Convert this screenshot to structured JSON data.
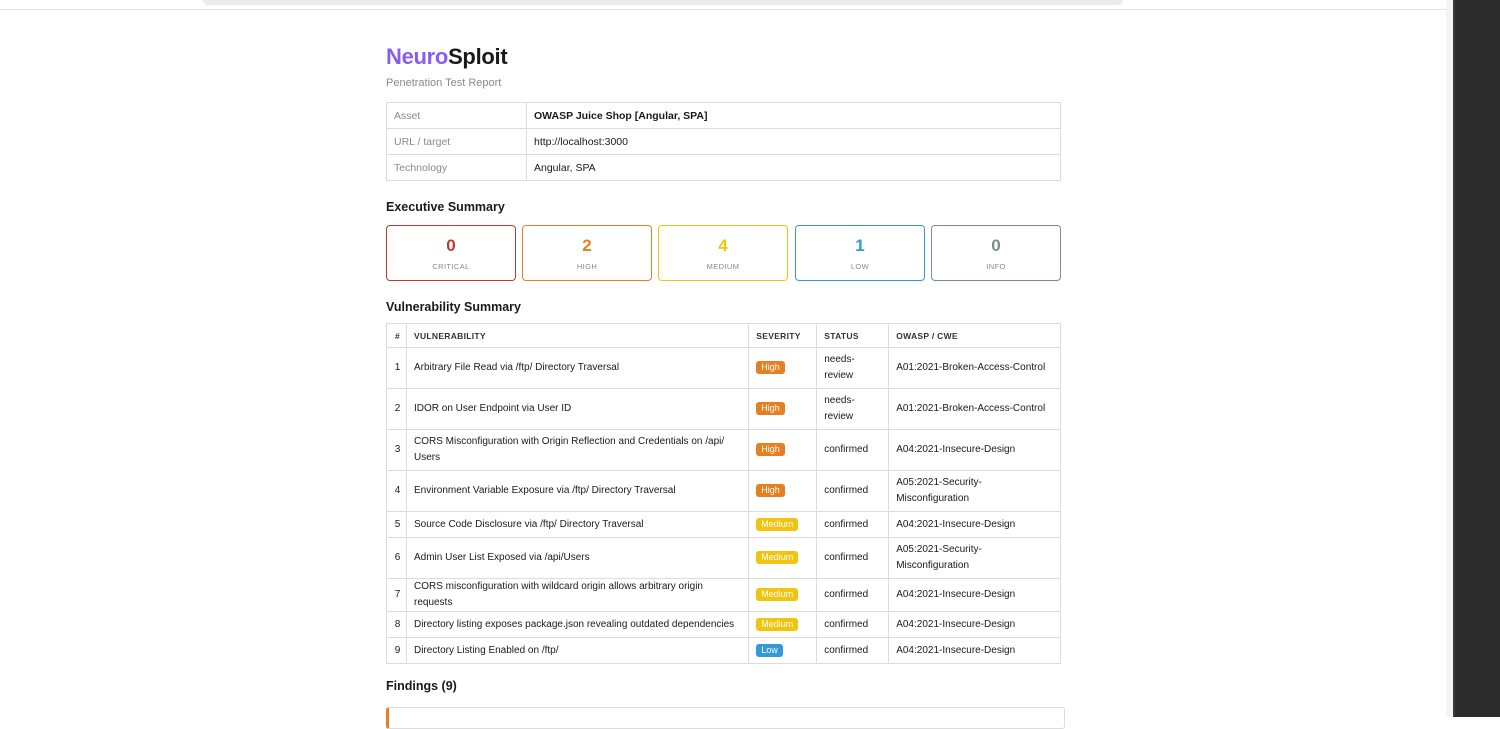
{
  "brand": {
    "part1": "Neuro",
    "part2": "Sploit"
  },
  "subtitle": "Penetration Test Report",
  "info": [
    {
      "key": "Asset",
      "value": "OWASP Juice Shop [Angular, SPA]"
    },
    {
      "key": "URL / target",
      "value": "http://localhost:3000"
    },
    {
      "key": "Technology",
      "value": "Angular, SPA"
    }
  ],
  "executive_summary": {
    "heading": "Executive Summary",
    "cards": [
      {
        "count": "0",
        "label": "CRITICAL",
        "color": "#c0392b"
      },
      {
        "count": "2",
        "label": "HIGH",
        "color": "#e67e22"
      },
      {
        "count": "4",
        "label": "MEDIUM",
        "color": "#f1c40f"
      },
      {
        "count": "1",
        "label": "LOW",
        "color": "#3498db"
      },
      {
        "count": "0",
        "label": "INFO",
        "color": "#7f8c8d"
      }
    ]
  },
  "vulnerability_summary": {
    "heading": "Vulnerability Summary",
    "columns": [
      "#",
      "VULNERABILITY",
      "SEVERITY",
      "STATUS",
      "OWASP / CWE"
    ],
    "rows": [
      {
        "num": "1",
        "name": "Arbitrary File Read via /ftp/ Directory Traversal",
        "severity": "High",
        "status": "needs-review",
        "owasp": "A01:2021-Broken-Access-Control"
      },
      {
        "num": "2",
        "name": "IDOR on User Endpoint via User ID",
        "severity": "High",
        "status": "needs-review",
        "owasp": "A01:2021-Broken-Access-Control"
      },
      {
        "num": "3",
        "name": "CORS Misconfiguration with Origin Reflection and Credentials on /api/ Users",
        "severity": "High",
        "status": "confirmed",
        "owasp": "A04:2021-Insecure-Design"
      },
      {
        "num": "4",
        "name": "Environment Variable Exposure via /ftp/ Directory Traversal",
        "severity": "High",
        "status": "confirmed",
        "owasp": "A05:2021-Security-Misconfiguration"
      },
      {
        "num": "5",
        "name": "Source Code Disclosure via /ftp/ Directory Traversal",
        "severity": "Medium",
        "status": "confirmed",
        "owasp": "A04:2021-Insecure-Design"
      },
      {
        "num": "6",
        "name": "Admin User List Exposed via /api/Users",
        "severity": "Medium",
        "status": "confirmed",
        "owasp": "A05:2021-Security-Misconfiguration"
      },
      {
        "num": "7",
        "name": "CORS misconfiguration with wildcard origin allows arbitrary origin requests",
        "severity": "Medium",
        "status": "confirmed",
        "owasp": "A04:2021-Insecure-Design"
      },
      {
        "num": "8",
        "name": "Directory listing exposes package.json revealing outdated dependencies",
        "severity": "Medium",
        "status": "confirmed",
        "owasp": "A04:2021-Insecure-Design"
      },
      {
        "num": "9",
        "name": "Directory Listing Enabled on /ftp/",
        "severity": "Low",
        "status": "confirmed",
        "owasp": "A04:2021-Insecure-Design"
      }
    ]
  },
  "severity_colors": {
    "High": "#e67e22",
    "Medium": "#f1c40f",
    "Low": "#3498db"
  },
  "findings": {
    "heading": "Findings (9)"
  }
}
